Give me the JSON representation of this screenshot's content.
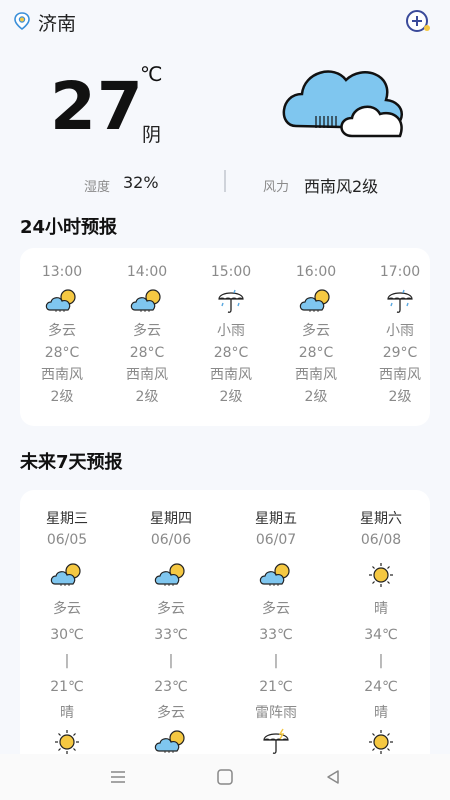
{
  "header": {
    "city": "济南",
    "location_icon": "location-pin-icon",
    "add_icon": "add-city-icon"
  },
  "current": {
    "temperature": "27",
    "unit": "℃",
    "condition": "阴",
    "icon": "cloudy-icon",
    "humidity_label": "湿度",
    "humidity_value": "32%",
    "wind_label": "风力",
    "wind_value": "西南风2级"
  },
  "hourly": {
    "title": "24小时预报",
    "items": [
      {
        "time": "13:00",
        "icon": "partly-cloudy-icon",
        "weather": "多云",
        "temp": "28°C",
        "wind_dir": "西南风",
        "wind_level": "2级"
      },
      {
        "time": "14:00",
        "icon": "partly-cloudy-icon",
        "weather": "多云",
        "temp": "28°C",
        "wind_dir": "西南风",
        "wind_level": "2级"
      },
      {
        "time": "15:00",
        "icon": "light-rain-icon",
        "weather": "小雨",
        "temp": "28°C",
        "wind_dir": "西南风",
        "wind_level": "2级"
      },
      {
        "time": "16:00",
        "icon": "partly-cloudy-icon",
        "weather": "多云",
        "temp": "28°C",
        "wind_dir": "西南风",
        "wind_level": "2级"
      },
      {
        "time": "17:00",
        "icon": "light-rain-icon",
        "weather": "小雨",
        "temp": "29°C",
        "wind_dir": "西南风",
        "wind_level": "2级"
      }
    ]
  },
  "daily": {
    "title": "未来7天预报",
    "items": [
      {
        "weekday": "星期三",
        "date": "06/05",
        "day_icon": "partly-cloudy-icon",
        "day_weather": "多云",
        "high": "30℃",
        "sep": "|",
        "low": "21℃",
        "night_weather": "晴",
        "night_icon": "sunny-icon"
      },
      {
        "weekday": "星期四",
        "date": "06/06",
        "day_icon": "partly-cloudy-icon",
        "day_weather": "多云",
        "high": "33℃",
        "sep": "|",
        "low": "23℃",
        "night_weather": "多云",
        "night_icon": "partly-cloudy-icon"
      },
      {
        "weekday": "星期五",
        "date": "06/07",
        "day_icon": "partly-cloudy-icon",
        "day_weather": "多云",
        "high": "33℃",
        "sep": "|",
        "low": "21℃",
        "night_weather": "雷阵雨",
        "night_icon": "thunder-rain-icon"
      },
      {
        "weekday": "星期六",
        "date": "06/08",
        "day_icon": "sunny-icon",
        "day_weather": "晴",
        "high": "34℃",
        "sep": "|",
        "low": "24℃",
        "night_weather": "晴",
        "night_icon": "sunny-icon"
      }
    ]
  },
  "navbar": {
    "menu_icon": "menu-icon",
    "home_icon": "home-square-icon",
    "back_icon": "back-triangle-icon"
  },
  "colors": {
    "background": "#f6f8fc",
    "card": "#ffffff",
    "cloud_blue": "#7fc6ef",
    "sun_yellow": "#f5c842"
  }
}
